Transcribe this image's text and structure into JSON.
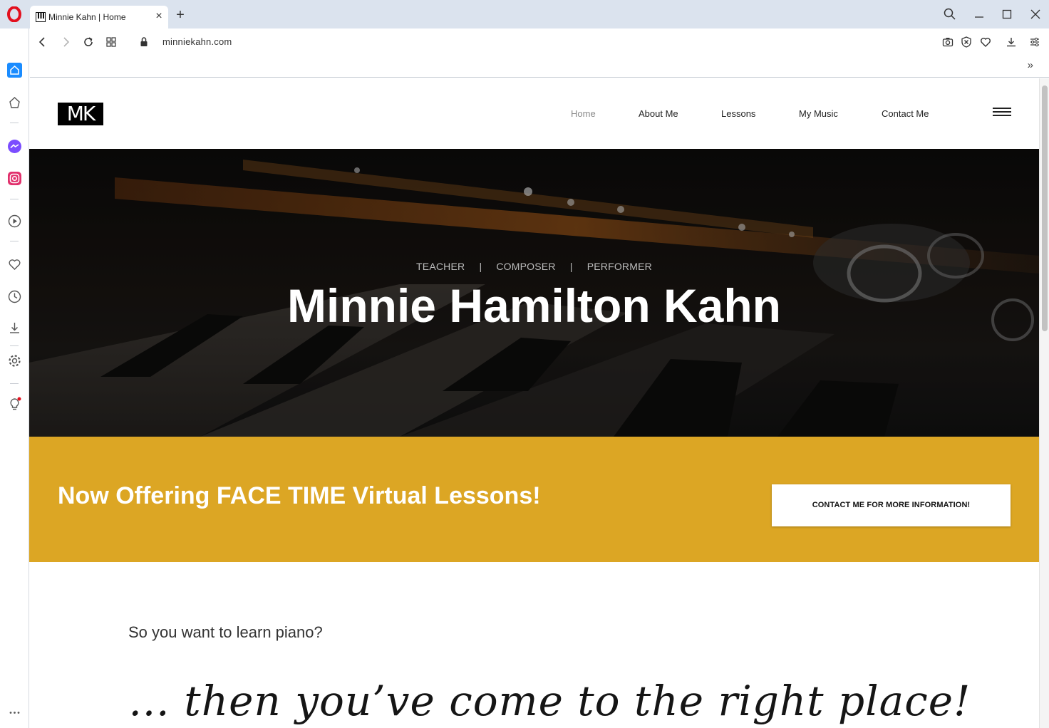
{
  "browser": {
    "tab_title": "Minnie Kahn | Home",
    "new_tab_label": "+",
    "tab_close_label": "×",
    "url": "minniekahn.com",
    "bookmarks_overflow": "»"
  },
  "site": {
    "logo_text": "MK",
    "nav": {
      "home": "Home",
      "about": "About Me",
      "lessons": "Lessons",
      "music": "My Music",
      "contact": "Contact Me"
    },
    "hero": {
      "roles": [
        "TEACHER",
        "|",
        "COMPOSER",
        "|",
        "PERFORMER"
      ],
      "title": "Minnie Hamilton Kahn"
    },
    "promo": {
      "text": "Now Offering FACE TIME Virtual Lessons!",
      "button": "CONTACT ME FOR MORE INFORMATION!"
    },
    "intro": "So you want to learn piano?",
    "script_line": "… then you’ve come to the right place!"
  },
  "colors": {
    "promo_bg": "#dca624",
    "opera_red": "#e3101e",
    "sidebar_active": "#1a8cff"
  }
}
